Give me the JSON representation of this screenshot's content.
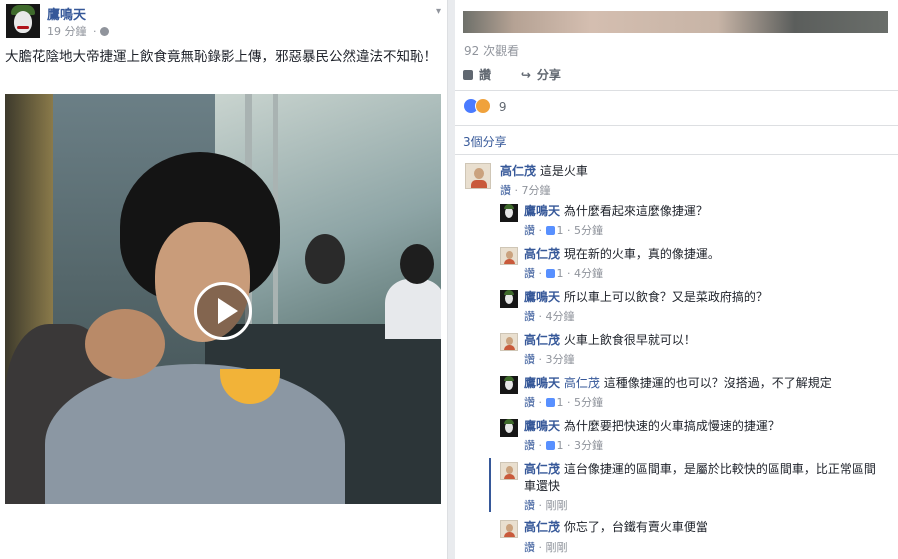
{
  "post": {
    "author": "鷹鳴天",
    "time": "19 分鐘",
    "text": "大膽花陰地大帝捷運上飲食竟無恥錄影上傳，邪惡暴民公然違法不知恥！"
  },
  "right": {
    "views": "92 次觀看",
    "like_label": "讚",
    "share_label": "分享",
    "reaction_count": "9",
    "shares_count": "3個分享"
  },
  "comments": [
    {
      "author": "高仁茂",
      "text": "這是火車",
      "time": "7分鐘",
      "like": "讚",
      "likes": ""
    },
    {
      "author": "鷹鳴天",
      "text": "為什麼看起來這麼像捷運？",
      "time": "5分鐘",
      "like": "讚",
      "likes": "1"
    },
    {
      "author": "高仁茂",
      "text": "現在新的火車，真的像捷運。",
      "time": "4分鐘",
      "like": "讚",
      "likes": "1"
    },
    {
      "author": "鷹鳴天",
      "text": "所以車上可以飲食？又是菜政府搞的？",
      "time": "4分鐘",
      "like": "讚",
      "likes": ""
    },
    {
      "author": "高仁茂",
      "text": "火車上飲食很早就可以！",
      "time": "3分鐘",
      "like": "讚",
      "likes": ""
    },
    {
      "author": "鷹鳴天",
      "tag": "高仁茂",
      "text": "這種像捷運的也可以？沒搭過，不了解規定",
      "time": "5分鐘",
      "like": "讚",
      "likes": "1"
    },
    {
      "author": "鷹鳴天",
      "text": "為什麼要把快速的火車搞成慢速的捷運？",
      "time": "3分鐘",
      "like": "讚",
      "likes": "1"
    },
    {
      "author": "高仁茂",
      "text": "這台像捷運的區間車，是屬於比較快的區間車，比正常區間車還快",
      "time": "剛剛",
      "like": "讚",
      "likes": ""
    },
    {
      "author": "高仁茂",
      "text": "你忘了，台鐵有賣火車便當",
      "time": "剛剛",
      "like": "讚",
      "likes": ""
    }
  ]
}
